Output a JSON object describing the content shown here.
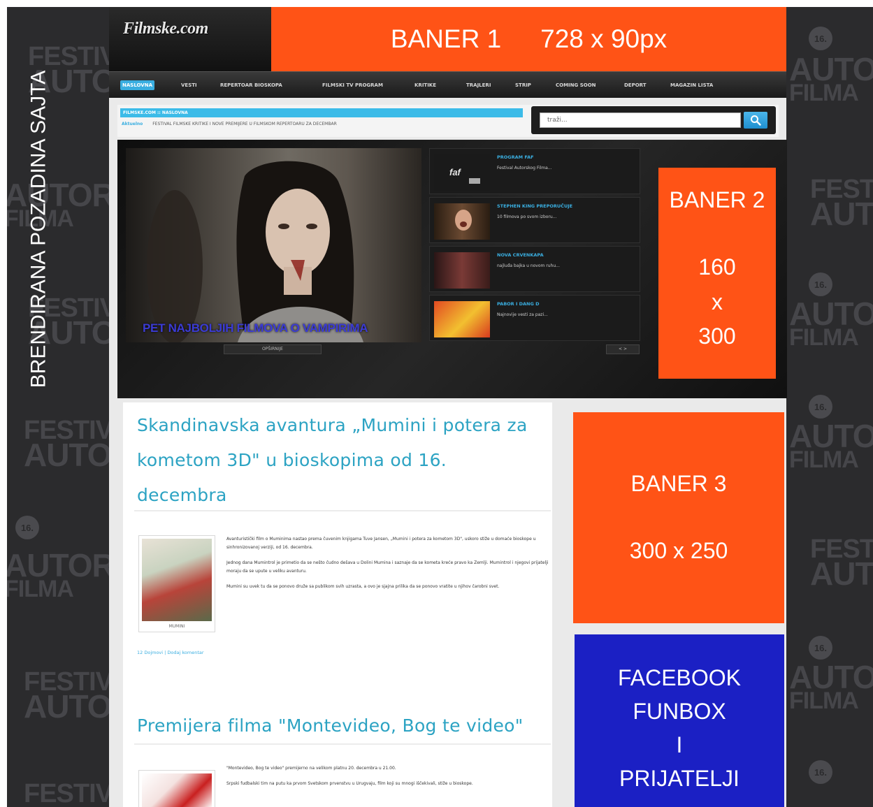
{
  "background": {
    "vertical_label": "BRENDIRANA POZADINA SAJTA",
    "watermark": {
      "badge": "16.",
      "festival": "FESTIVAL",
      "autorskog": "AUTORSKOG",
      "filma": "FILMA"
    },
    "color": "#2b2b2d"
  },
  "header": {
    "logo": "Filmske.com",
    "banner1": {
      "name": "BANER 1",
      "size": "728 x 90px",
      "color": "#ff5316"
    }
  },
  "nav": {
    "items": [
      "NASLOVNA",
      "VESTI",
      "REPERTOAR BIOSKOPA",
      "FILMSKI TV PROGRAM",
      "KRITIKE",
      "TRAJLERI",
      "STRIP",
      "COMING SOON",
      "DEPORT",
      "MAGAZIN LISTA"
    ],
    "accent": "#3aaee0"
  },
  "subbar": {
    "breadcrumb": "FILMSKE.COM :: NASLOVNA",
    "ticker_label": "Aktuelno",
    "ticker_text": "FESTIVAL FILMSKE KRITIKE I NOVE PREMIJERE U FILMSKOM REPERTOARU ZA DECEMBAR",
    "search_placeholder": "traži..."
  },
  "featured": {
    "caption": "PET NAJBOLJIH FILMOVA O VAMPIRIMA",
    "more_label": "OPŠIRNIJE",
    "nav_label": "< >",
    "items": [
      {
        "title": "PROGRAM FAF",
        "desc": "Festival Autorskog Filma..."
      },
      {
        "title": "STEPHEN KING PREPORUČUJE",
        "desc": "10 filmova po svom izboru..."
      },
      {
        "title": "NOVA CRVENKAPA",
        "desc": "najluđa bajka u novom ruhu..."
      },
      {
        "title": "PABOR I DANG D",
        "desc": "Najnovije vesti za pazi..."
      }
    ],
    "banner2": {
      "name": "BANER  2",
      "w": "160",
      "x": "x",
      "h": "300",
      "color": "#ff5316"
    }
  },
  "posts": [
    {
      "title_lines": [
        "Skandinavska avantura „Mumini i potera za",
        "kometom 3D\" u bioskopima od 16.",
        "decembra"
      ],
      "image_caption": "MUMINI",
      "paragraphs": [
        "Avanturistički film o Muminima nastao prema čuvenim knjigama Tuve Jansen, „Mumini i potera za kometom 3D\", uskoro stiže u domaće bioskope u sinhronizovanoj verziji, od 16. decembra.",
        "Jednog dana Mumintrol je primetio da se nešto čudno dešava u Dolini Mumina i saznaje da se kometa kreće pravo ka Zemlji. Mumintrol i njegovi prijatelji moraju da se upute u veliku avanturu.",
        "Mumini su uvek tu da se ponovo druže sa publikom svih uzrasta, a ovo je sjajna prilika da se ponovo vratite u njihov čarobni svet."
      ],
      "meta": "12 Dojmovi | Dodaj komentar"
    },
    {
      "title_lines": [
        "Premijera filma \"Montevideo, Bog te video\""
      ],
      "paragraphs": [
        "\"Montevideo, Bog te video\" premijerno na velikom platnu 20. decembra u 21.00.",
        "Srpski fudbalski tim na putu ka prvom Svetskom prvenstvu u Urugvaju, film koji su mnogi iščekivali, stiže u bioskope."
      ]
    }
  ],
  "sidebar": {
    "banner3": {
      "name": "BANER 3",
      "size": "300 x 250",
      "color": "#ff5316"
    },
    "funbox": {
      "lines": [
        "FACEBOOK",
        "FUNBOX",
        "I",
        "PRIJATELJI"
      ],
      "color": "#1b20c4"
    }
  }
}
